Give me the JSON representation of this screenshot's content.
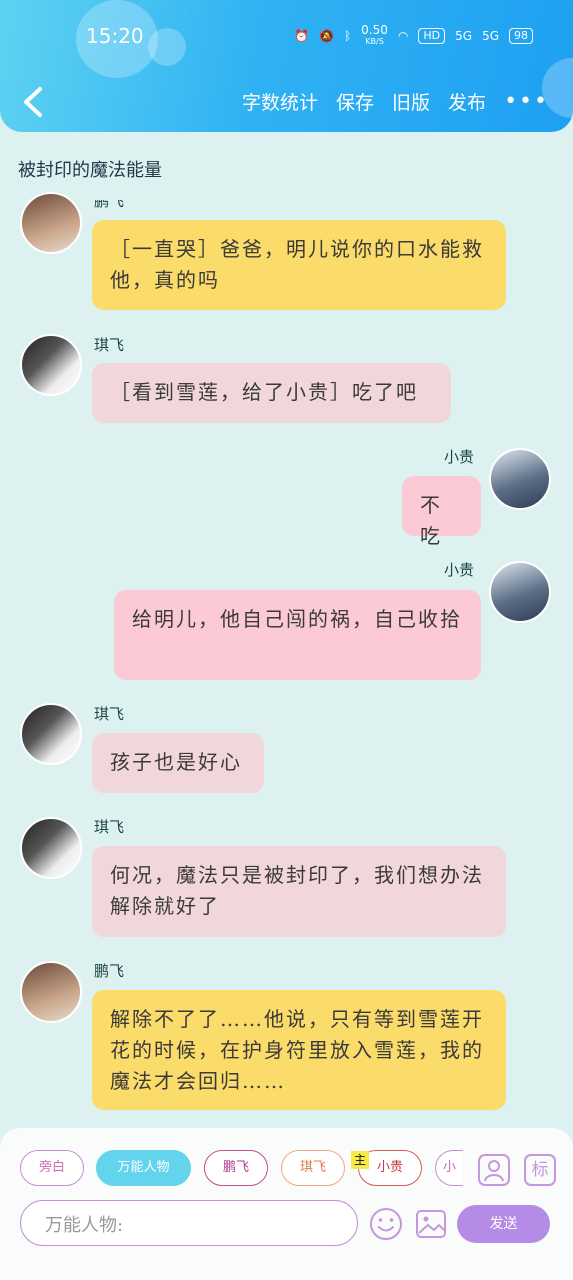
{
  "status_bar": {
    "time": "15:20",
    "net_speed": "0.50",
    "net_unit": "KB/S",
    "hd": "HD",
    "sig1": "5G",
    "sig2": "5G",
    "battery": "98"
  },
  "toolbar": {
    "word_count": "字数统计",
    "save": "保存",
    "old_version": "旧版",
    "publish": "发布",
    "more": "•••"
  },
  "page_title": "被封印的魔法能量",
  "messages": [
    {
      "name": "鹏飞",
      "text": "［一直哭］爸爸，明儿说你的口水能救他，真的吗"
    },
    {
      "name": "琪飞",
      "text": "［看到雪莲，给了小贵］吃了吧"
    },
    {
      "name": "小贵",
      "text": "不吃"
    },
    {
      "name": "小贵",
      "text": "给明儿，他自己闯的祸，自己收拾"
    },
    {
      "name": "琪飞",
      "text": "孩子也是好心"
    },
    {
      "name": "琪飞",
      "text": "何况，魔法只是被封印了，我们想办法解除就好了"
    },
    {
      "name": "鹏飞",
      "text": "解除不了了……他说，只有等到雪莲开花的时候，在护身符里放入雪莲，我的魔法才会回归……"
    }
  ],
  "bottom_bar": {
    "chips": [
      "旁白",
      "万能人物",
      "鹏飞",
      "琪飞",
      "小贵",
      "小"
    ],
    "main_badge": "主",
    "tag_icon": "标",
    "input_placeholder": "万能人物:",
    "send": "发送"
  },
  "colors": {
    "header": "#2fb2f3",
    "yellow_bubble": "#fbdc6b",
    "pink_bubble": "#f2d7da",
    "send_button": "#b48be6"
  }
}
